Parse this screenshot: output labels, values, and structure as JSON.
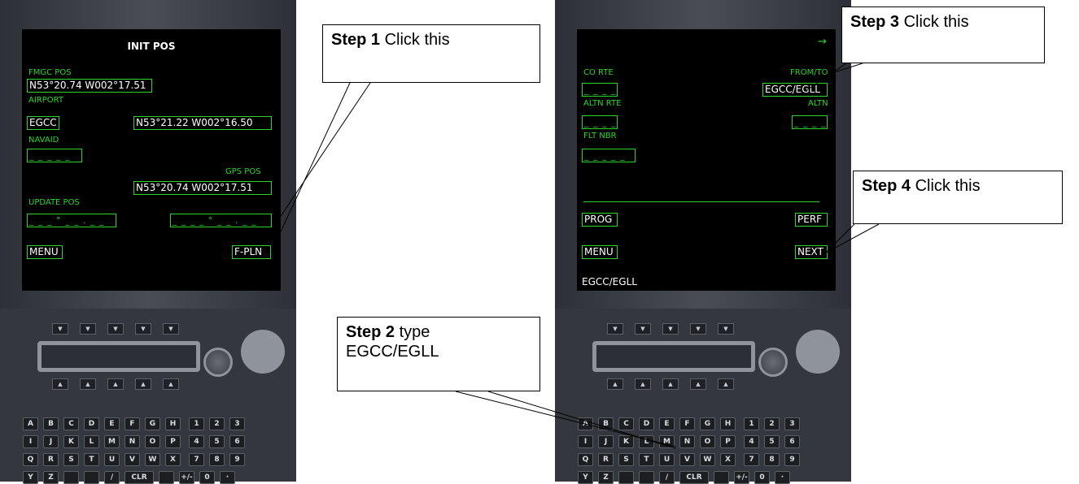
{
  "left_mcdu": {
    "title": "INIT POS",
    "fmgc_pos_label": "FMGC POS",
    "fmgc_pos_value": "N53°20.74 W002°17.51",
    "airport_label": "AIRPORT",
    "airport_value": "EGCC",
    "airport_coords": "N53°21.22 W002°16.50",
    "navaid_label": "NAVAID",
    "navaid_value": "_ _ _ _ _",
    "gps_pos_label": "GPS POS",
    "gps_pos_value": "N53°20.74 W002°17.51",
    "update_pos_label": "UPDATE POS",
    "update_left": "_ _ _ ° _ _ . _ _",
    "update_right": "_ _ _ _ ° _ _ . _ _",
    "menu_label": "MENU",
    "fpln_label": "F-PLN"
  },
  "right_mcdu": {
    "arrow": "→",
    "co_rte_label": "CO RTE",
    "co_rte_value": "_ _ _ _",
    "from_to_label": "FROM/TO",
    "from_to_value": "EGCC/EGLL",
    "altn_rte_label": "ALTN RTE",
    "altn_rte_value": "_ _ _ _",
    "altn_label": "ALTN",
    "altn_value": "_ _ _ _",
    "flt_nbr_label": "FLT NBR",
    "flt_nbr_value": "_ _ _ _ _",
    "prog_label": "PROG",
    "perf_label": "PERF",
    "menu_label": "MENU",
    "next_label": "NEXT",
    "scratchpad": "EGCC/EGLL"
  },
  "keyboard": {
    "arrow_down": "▼",
    "arrow_up": "▲",
    "rows": [
      [
        "A",
        "B",
        "C",
        "D",
        "E",
        "F",
        "G",
        "H",
        "1",
        "2",
        "3"
      ],
      [
        "I",
        "J",
        "K",
        "L",
        "M",
        "N",
        "O",
        "P",
        "4",
        "5",
        "6"
      ],
      [
        "Q",
        "R",
        "S",
        "T",
        "U",
        "V",
        "W",
        "X",
        "7",
        "8",
        "9"
      ],
      [
        "Y",
        "Z",
        "",
        "",
        "/",
        "CLR",
        "",
        "+/-",
        "0",
        "·"
      ]
    ]
  },
  "callouts": {
    "step1_bold": "Step 1",
    "step1_text": " Click this",
    "step2_bold": "Step 2",
    "step2_text": " type",
    "step2_value": "EGCC/EGLL",
    "step3_bold": "Step 3",
    "step3_text": " Click this",
    "step4_bold": "Step 4",
    "step4_text": " Click this"
  },
  "colors": {
    "screen_label": "#2bd52b",
    "screen_value": "#ffffff",
    "screen_bg": "#000000"
  }
}
